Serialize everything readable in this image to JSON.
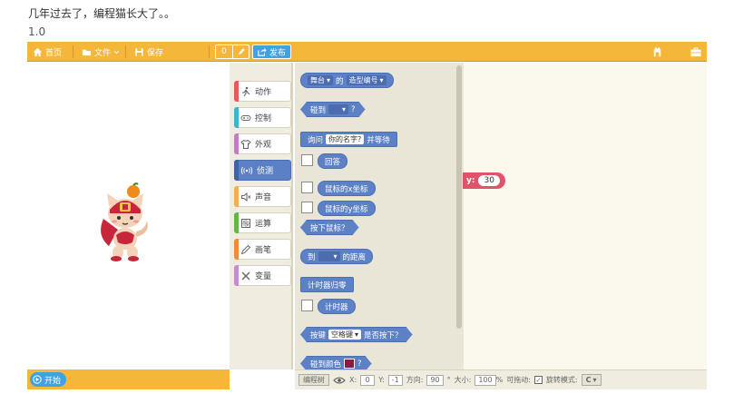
{
  "caption": "几年过去了，编程猫长大了。。",
  "version": "1.0",
  "toolbar": {
    "home": "首页",
    "file": "文件",
    "save": "保存",
    "counter": "0",
    "publish": "发布"
  },
  "stage": {
    "start_label": "开始"
  },
  "categories": [
    {
      "label": "动作",
      "icon": "move-icon",
      "color": "#e55b5b"
    },
    {
      "label": "控制",
      "icon": "gamepad-icon",
      "color": "#39b7c9"
    },
    {
      "label": "外观",
      "icon": "shirt-icon",
      "color": "#c879c8"
    },
    {
      "label": "侦测",
      "icon": "signal-icon",
      "color": "#5b80c6"
    },
    {
      "label": "声音",
      "icon": "speaker-icon",
      "color": "#f0b050"
    },
    {
      "label": "运算",
      "icon": "calculator-icon",
      "color": "#63b54a"
    },
    {
      "label": "画笔",
      "icon": "pen-icon",
      "color": "#f08a3c"
    },
    {
      "label": "变量",
      "icon": "variable-icon",
      "color": "#c88ad2"
    }
  ],
  "blocks": {
    "b1_stage": "舞台",
    "b1_of": "的",
    "b1_attr": "造型编号",
    "b2_touch": "碰到",
    "b2_q": "?",
    "b3_ask": "询问",
    "b3_default": "你的名字?",
    "b3_wait": "并等待",
    "b4_answer": "回答",
    "b5_mousex": "鼠标的x坐标",
    "b6_mousey": "鼠标的y坐标",
    "b7_mousedown": "按下鼠标？",
    "b8_to": "到",
    "b8_distance": "的距离",
    "b9_resettimer": "计时器归零",
    "b10_timer": "计时器",
    "b11_key": "按键",
    "b11_space": "空格键",
    "b11_pressed": "是否按下？",
    "b12_touchcolor": "碰到颜色",
    "b12_q": "?"
  },
  "script_block": {
    "y_label": "y:",
    "y_value": "30"
  },
  "status": {
    "program_tree": "编程树",
    "x_label": "X:",
    "x_value": "0",
    "y_label": "Y:",
    "y_value": "-1",
    "direction_label": "方向:",
    "direction_value": "90",
    "degree": "°",
    "size_label": "大小:",
    "size_value": "100",
    "percent": "%",
    "draggable_label": "可拖动:",
    "rotate_label": "旋转模式:",
    "rotate_value": "C"
  }
}
